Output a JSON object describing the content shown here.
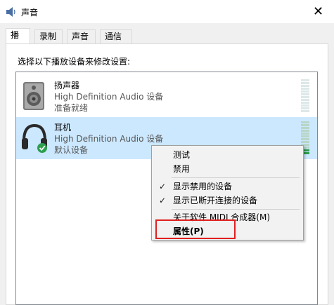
{
  "window": {
    "title": "声音",
    "close_glyph": "✕"
  },
  "tabs": [
    {
      "label": "播放",
      "active": true
    },
    {
      "label": "录制",
      "active": false
    },
    {
      "label": "声音",
      "active": false
    },
    {
      "label": "通信",
      "active": false
    }
  ],
  "instruction": "选择以下播放设备来修改设置:",
  "devices": [
    {
      "name": "扬声器",
      "description": "High Definition Audio 设备",
      "status": "准备就绪",
      "icon": "speaker-icon",
      "selected": false
    },
    {
      "name": "耳机",
      "description": "High Definition Audio 设备",
      "status": "默认设备",
      "icon": "headphones-icon",
      "selected": true,
      "default_badge": "check-badge-icon"
    }
  ],
  "context_menu": {
    "items": [
      {
        "label": "测试",
        "checked": false
      },
      {
        "label": "禁用",
        "checked": false
      },
      {
        "label": "显示禁用的设备",
        "checked": true
      },
      {
        "label": "显示已断开连接的设备",
        "checked": true
      },
      {
        "label": "关于软件 MIDI 合成器(M)",
        "checked": false
      },
      {
        "label": "属性(P)",
        "checked": false,
        "bold": true,
        "highlighted": true
      }
    ],
    "check_glyph": "✓"
  },
  "colors": {
    "selection": "#cce8ff",
    "highlight_border": "#e02020",
    "meter_lit": "#2e9e4f"
  }
}
